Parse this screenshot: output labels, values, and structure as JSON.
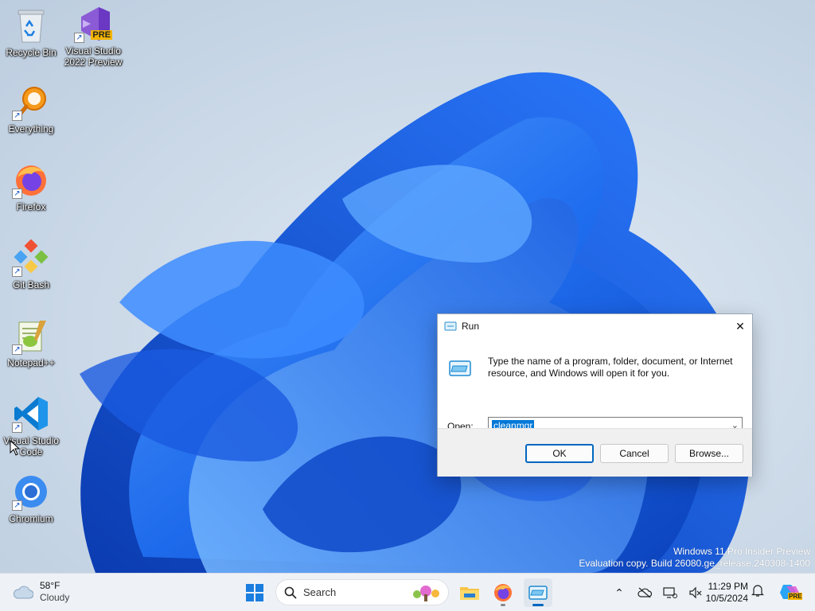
{
  "desktop": {
    "icons": [
      {
        "label": "Recycle Bin"
      },
      {
        "label": "Visual Studio 2022 Preview",
        "badge": "PRE"
      },
      {
        "label": "Everything"
      },
      {
        "label": "Firefox"
      },
      {
        "label": "Git Bash"
      },
      {
        "label": "Notepad++"
      },
      {
        "label": "Visual Studio Code"
      },
      {
        "label": "Chromium"
      }
    ],
    "watermark": {
      "line1": "Windows 11 Pro Insider Preview",
      "line2": "Evaluation copy. Build 26080.ge_release.240308-1400"
    }
  },
  "run_dialog": {
    "title": "Run",
    "close_glyph": "✕",
    "description": "Type the name of a program, folder, document, or Internet resource, and Windows will open it for you.",
    "open_label": "Open:",
    "open_value": "cleanmgr",
    "buttons": {
      "ok": "OK",
      "cancel": "Cancel",
      "browse": "Browse..."
    }
  },
  "taskbar": {
    "weather": {
      "temp": "58°F",
      "condition": "Cloudy"
    },
    "search_placeholder": "Search",
    "clock": {
      "time": "11:29 PM",
      "date": "10/5/2024"
    },
    "copilot_badge": "PRE"
  },
  "colors": {
    "accent": "#0067c0",
    "selection": "#0078d7",
    "bloom": "#1e63e6"
  }
}
